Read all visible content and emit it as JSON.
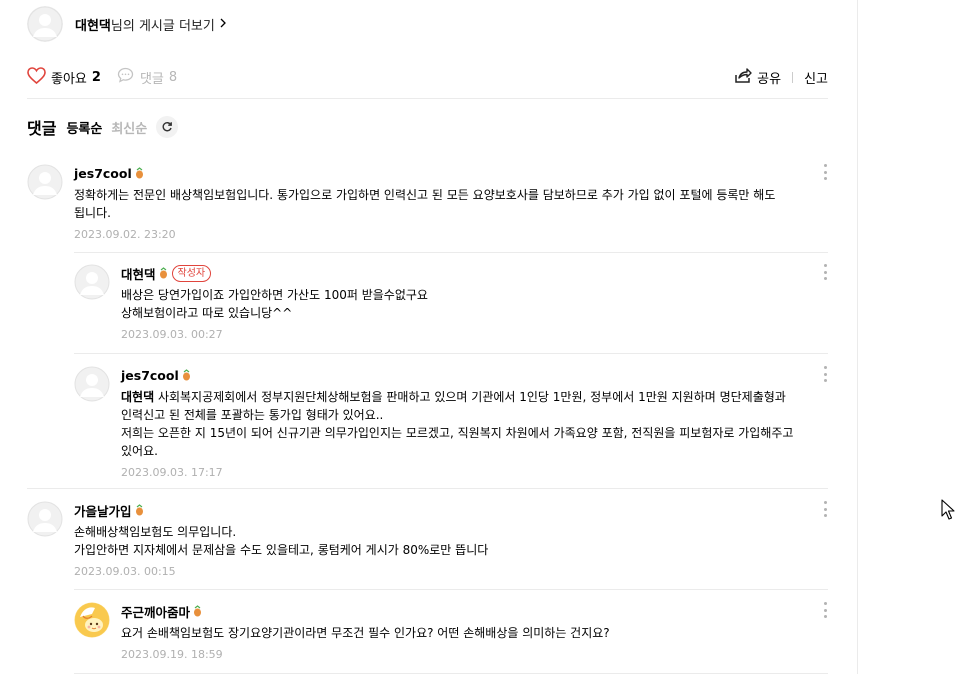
{
  "more_posts": {
    "author": "대현댁",
    "suffix": "님의 게시글 더보기"
  },
  "actions": {
    "like_label": "좋아요",
    "like_count": "2",
    "comment_label": "댓글",
    "comment_count": "8",
    "share_label": "공유",
    "report_label": "신고"
  },
  "comments_header": {
    "title": "댓글",
    "sort_registered": "등록순",
    "sort_latest": "최신순"
  },
  "comments": [
    {
      "nick": "jes7cool",
      "text": "정확하게는 전문인 배상책임보험입니다. 통가입으로 가입하면 인력신고 된 모든 요양보호사를 담보하므로 추가 가입 없이 포털에 등록만 해도 됩니다.",
      "date": "2023.09.02. 23:20"
    },
    {
      "nick": "대현댁",
      "author_badge": "작성자",
      "text": "배상은 당연가입이죠 가입안하면 가산도 100퍼 받을수없구요\n상해보험이라고 따로 있습니당^^",
      "date": "2023.09.03. 00:27"
    },
    {
      "nick": "jes7cool",
      "mention": "대현댁",
      "text": " 사회복지공제회에서 정부지원단체상해보험을 판매하고 있으며 기관에서 1인당 1만원, 정부에서 1만원 지원하며 명단제출형과 인력신고 된 전체를 포괄하는 통가입 형태가 있어요..\n저희는 오픈한 지 15년이 되어 신규기관 의무가입인지는 모르겠고, 직원복지 차원에서 가족요양 포함, 전직원을 피보험자로 가입해주고 있어요.",
      "date": "2023.09.03. 17:17"
    },
    {
      "nick": "가을날가입",
      "text": "손해배상책임보험도 의무입니다.\n가입안하면 지자체에서 문제삼을 수도 있을테고, 롱텀케어 게시가 80%로만 뜹니다",
      "date": "2023.09.03. 00:15"
    },
    {
      "nick": "주근깨아줌마",
      "text": "요거 손배책임보험도 장기요양기관이라면 무조건 필수 인가요? 어떤 손해배상을 의미하는 건지요?",
      "date": "2023.09.19. 18:59"
    }
  ],
  "colors": {
    "accent_red": "#e0443c",
    "muted": "#b0b0b0",
    "divider": "#ebebeb"
  },
  "icons": [
    "default-avatar-icon",
    "chevron-right-icon",
    "heart-icon",
    "comment-icon",
    "share-icon",
    "refresh-icon",
    "level-badge-icon",
    "more-vertical-icon",
    "mouse-cursor-icon"
  ]
}
